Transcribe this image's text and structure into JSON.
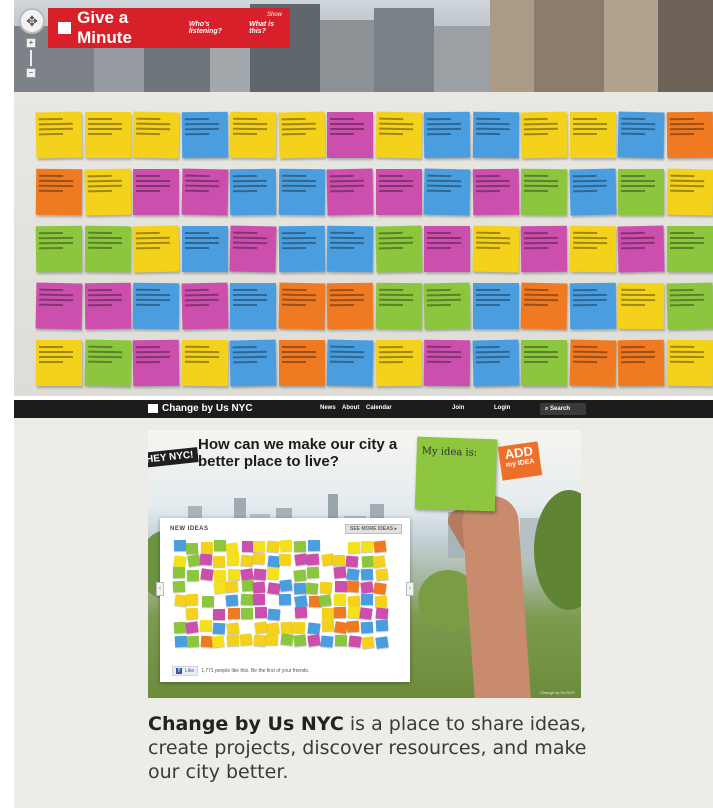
{
  "give_a_minute": {
    "title": "Give a Minute",
    "links": [
      "Who's listening?",
      "What is this?"
    ],
    "show_label": "Show",
    "note_colors": [
      "#f4d11b",
      "#4a9ee0",
      "#cc4fae",
      "#8cc63f",
      "#f07a22",
      "#f4e11b"
    ]
  },
  "change_by_us": {
    "logo": "Change by Us NYC",
    "nav": [
      "News",
      "About",
      "Calendar",
      "Join",
      "Login"
    ],
    "search_label": "Search",
    "hero": {
      "badge": "HEY NYC!",
      "headline": "How can we make our city a better place to live?",
      "card_label": "My idea is:",
      "add_tag_line1": "ADD",
      "add_tag_line2": "my IDEA",
      "credit": "Change by Us NYC"
    },
    "panel": {
      "title": "NEW IDEAS",
      "see_more": "SEE MORE IDEAS",
      "like_button": "Like",
      "like_text": "1,771 people like this. Be the first of your friends."
    },
    "tagline_bold": "Change by Us NYC",
    "tagline_rest": " is a place to share ideas, create projects, discover resources, and make our city better."
  }
}
